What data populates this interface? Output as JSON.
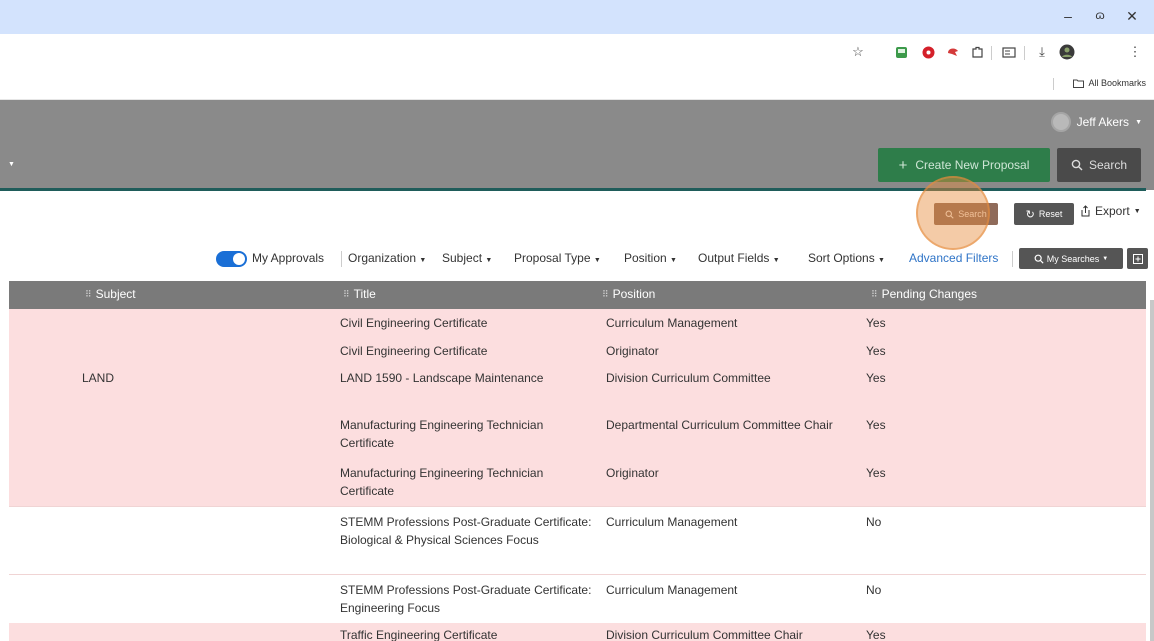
{
  "window": {
    "minimize_glyph": "–",
    "restore_glyph": "ɷ",
    "close_glyph": "✕"
  },
  "toolbar": {
    "bookmarks_label": "All Bookmarks"
  },
  "header": {
    "user_name": "Jeff Akers",
    "create_label": "Create New Proposal",
    "search_label": "Search"
  },
  "actions": {
    "search_label": "Search",
    "reset_label": "Reset",
    "export_label": "Export"
  },
  "filters": {
    "my_approvals_label": "My Approvals",
    "my_approvals_on": true,
    "organization": "Organization",
    "subject": "Subject",
    "proposal_type": "Proposal Type",
    "position": "Position",
    "output_fields": "Output Fields",
    "sort_options": "Sort Options",
    "advanced_filters": "Advanced Filters",
    "my_searches": "My Searches"
  },
  "table": {
    "columns": [
      "Subject",
      "Title",
      "Position",
      "Pending Changes"
    ],
    "rows": [
      {
        "subject": "",
        "title": "Civil Engineering Certificate",
        "position": "Curriculum Management",
        "pending": "Yes"
      },
      {
        "subject": "",
        "title": "Civil Engineering Certificate",
        "position": "Originator",
        "pending": "Yes"
      },
      {
        "subject": "LAND",
        "title": "LAND 1590 - Landscape Maintenance",
        "position": "Division Curriculum Committee",
        "pending": "Yes"
      },
      {
        "subject": "",
        "title": "Manufacturing Engineering Technician Certificate",
        "position": "Departmental Curriculum Committee Chair",
        "pending": "Yes"
      },
      {
        "subject": "",
        "title": "Manufacturing Engineering Technician Certificate",
        "position": "Originator",
        "pending": "Yes"
      },
      {
        "subject": "",
        "title": "STEMM Professions Post-Graduate Certificate: Biological & Physical Sciences Focus",
        "position": "Curriculum Management",
        "pending": "No"
      },
      {
        "subject": "",
        "title": "STEMM Professions Post-Graduate Certificate: Engineering Focus",
        "position": "Curriculum Management",
        "pending": "No"
      },
      {
        "subject": "",
        "title": "Traffic Engineering Certificate",
        "position": "Division Curriculum Committee Chair",
        "pending": "Yes"
      }
    ]
  },
  "colors": {
    "pending_row": "#fcdedf",
    "create_button": "#2e7d4a",
    "toggle_on": "#1a6fd6"
  }
}
